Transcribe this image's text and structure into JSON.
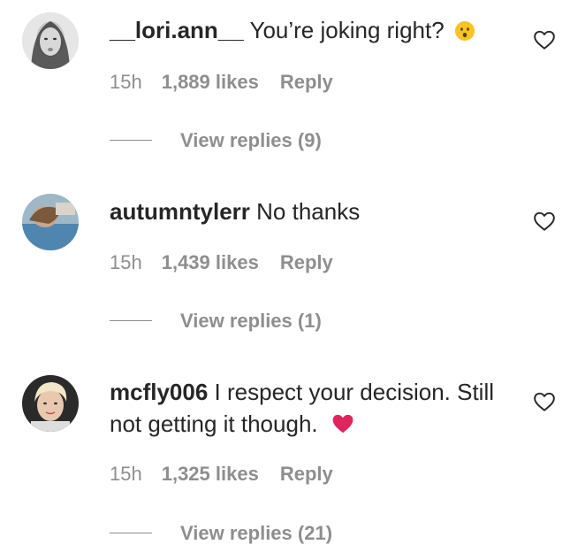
{
  "comments": [
    {
      "username": "__lori.ann__",
      "text": "You’re joking right?",
      "emoji_icon": "hushed-face-emoji",
      "time": "15h",
      "likes": "1,889 likes",
      "reply_label": "Reply",
      "view_replies_label": "View replies (9)"
    },
    {
      "username": "autumntylerr",
      "text": "No thanks",
      "time": "15h",
      "likes": "1,439 likes",
      "reply_label": "Reply",
      "view_replies_label": "View replies (1)"
    },
    {
      "username": "mcfly006",
      "text": "I respect your decision. Still not getting it though.",
      "emoji_icon": "red-heart-emoji",
      "time": "15h",
      "likes": "1,325 likes",
      "reply_label": "Reply",
      "view_replies_label": "View replies (21)"
    }
  ],
  "colors": {
    "text": "#262626",
    "muted": "#8e8e8e",
    "heart_emoji": "#e0245e"
  }
}
